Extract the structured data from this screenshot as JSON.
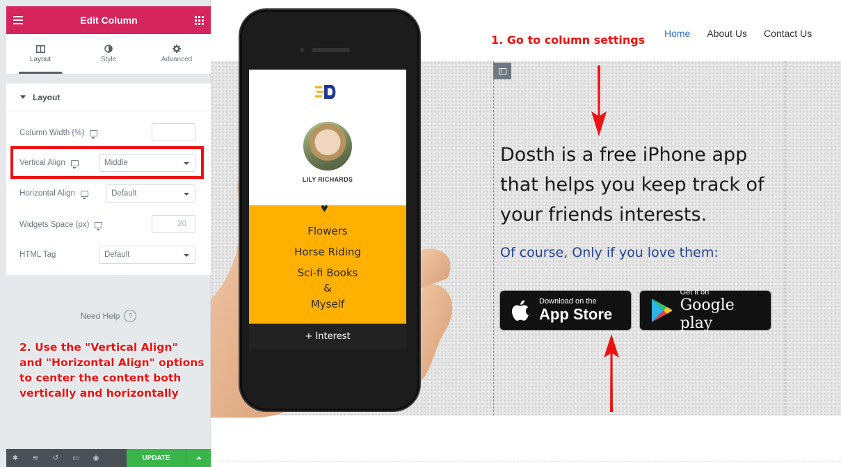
{
  "editor": {
    "header": {
      "title": "Edit Column"
    },
    "tabs": [
      {
        "label": "Layout",
        "icon": "columns-icon"
      },
      {
        "label": "Style",
        "icon": "half-circle-icon"
      },
      {
        "label": "Advanced",
        "icon": "gear-icon"
      }
    ],
    "section": {
      "title": "Layout"
    },
    "controls": {
      "column_width": {
        "label": "Column Width (%)",
        "value": ""
      },
      "vertical_align": {
        "label": "Vertical Align",
        "value": "Middle"
      },
      "horizontal_align": {
        "label": "Horizontal Align",
        "value": "Default"
      },
      "widgets_space": {
        "label": "Widgets Space (px)",
        "placeholder": "20"
      },
      "html_tag": {
        "label": "HTML Tag",
        "value": "Default"
      }
    },
    "need_help": "Need Help",
    "footer": {
      "update_label": "UPDATE"
    }
  },
  "nav": {
    "items": [
      "Home",
      "About Us",
      "Contact Us"
    ],
    "active": "Home"
  },
  "phone": {
    "name": "LILY RICHARDS",
    "interests": [
      "Flowers",
      "Horse Riding",
      "Sci-fi Books",
      "&",
      "Myself"
    ],
    "bar_label": "+ Interest"
  },
  "content": {
    "headline": [
      "Dosth is a free iPhone app",
      "that helps you keep track of",
      "your friends interests."
    ],
    "subline": "Of course, Only if you love them:",
    "appstore": {
      "small": "Download on the",
      "big": "App Store"
    },
    "googleplay": {
      "small": "Get it on",
      "big": "Google play"
    }
  },
  "annotations": {
    "step1": "1. Go to column settings",
    "step2": [
      "2. Use the \"Vertical Align\"",
      "and \"Horizontal Align\" options",
      "to center the content both",
      "vertically and horizontally"
    ]
  },
  "colors": {
    "brand": "#d5255f",
    "accent": "#ee1111",
    "update": "#39b54a",
    "link": "#2c6ed5",
    "sub": "#23439b",
    "phone_panel": "#ffb000"
  }
}
